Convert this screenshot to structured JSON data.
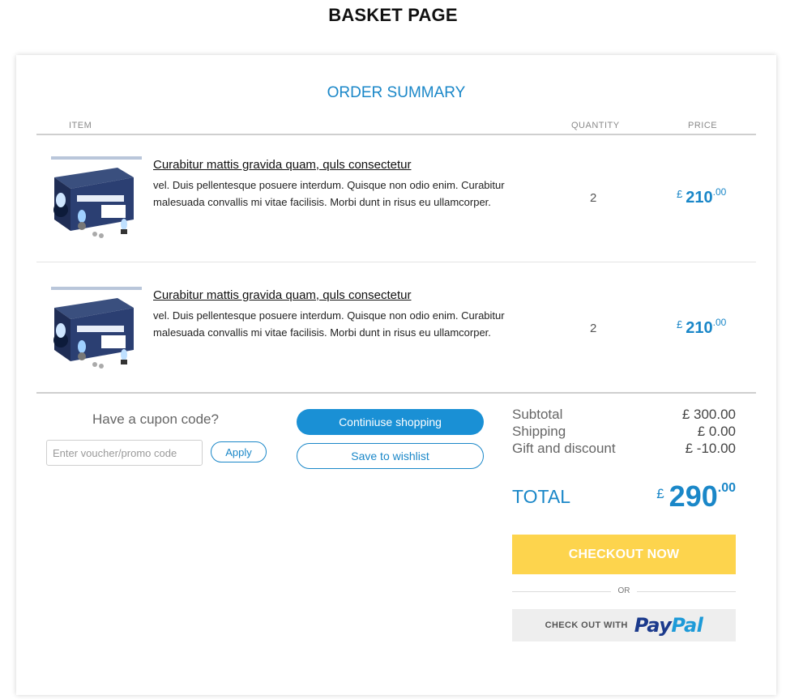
{
  "page": {
    "title": "BASKET PAGE"
  },
  "summary": {
    "title": "ORDER SUMMARY",
    "columns": {
      "item": "ITEM",
      "quantity": "QUANTITY",
      "price": "PRICE"
    }
  },
  "items": [
    {
      "title": "Curabitur mattis gravida quam, quls consectetur",
      "description": "vel. Duis pellentesque posuere interdum. Quisque non odio enim. Curabitur malesuada convallis mi vitae facilisis. Morbi dunt in risus eu ullamcorper.",
      "quantity": "2",
      "currency": "£",
      "price_int": "210",
      "price_dec": ".00",
      "image_icon": "headlight-bulb-kit-product-image"
    },
    {
      "title": "Curabitur mattis gravida quam, quls consectetur",
      "description": "vel. Duis pellentesque posuere interdum. Quisque non odio enim. Curabitur malesuada convallis mi vitae facilisis. Morbi dunt in risus eu ullamcorper.",
      "quantity": "2",
      "currency": "£",
      "price_int": "210",
      "price_dec": ".00",
      "image_icon": "headlight-bulb-kit-product-image"
    }
  ],
  "coupon": {
    "label": "Have a cupon code?",
    "placeholder": "Enter voucher/promo code",
    "apply_label": "Apply"
  },
  "actions": {
    "continue_label": "Continiuse shopping",
    "wishlist_label": "Save to wishlist"
  },
  "totals": {
    "subtotal_label": "Subtotal",
    "subtotal_value": "£ 300.00",
    "shipping_label": "Shipping",
    "shipping_value": "£ 0.00",
    "discount_label": "Gift and discount",
    "discount_value": "£ -10.00",
    "total_label": "TOTAL",
    "total_currency": "£",
    "total_int": "290",
    "total_dec": ".00"
  },
  "checkout": {
    "button_label": "CHECKOUT NOW",
    "or_label": "OR",
    "paypal_prefix": "CHECK OUT WITH",
    "paypal_logo_a": "Pay",
    "paypal_logo_b": "Pal"
  },
  "colors": {
    "accent": "#1a87c8",
    "checkout": "#fdd44d",
    "paypal_dark": "#1b3a8c",
    "paypal_light": "#1d9ad8"
  }
}
